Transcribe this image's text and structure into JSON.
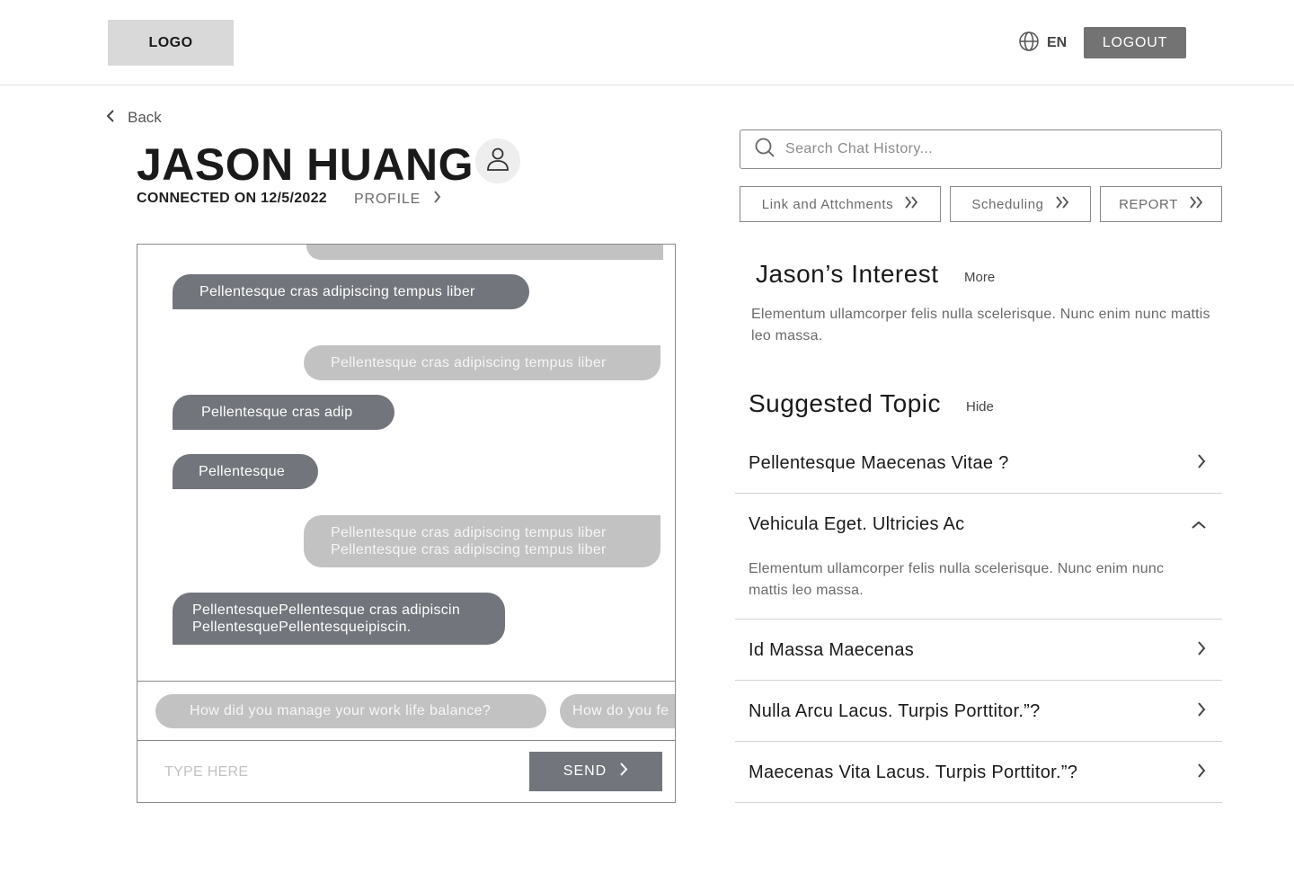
{
  "header": {
    "logo_text": "LOGO",
    "language": "EN",
    "logout_label": "LOGOUT"
  },
  "nav": {
    "back_label": "Back"
  },
  "contact": {
    "name": "JASON HUANG",
    "connected": "CONNECTED ON 12/5/2022",
    "profile_label": "PROFILE"
  },
  "chat": {
    "messages": [
      {
        "side": "in",
        "lines": [
          "Pellentesque cras adipiscing tempus liber"
        ]
      },
      {
        "side": "out",
        "lines": [
          "Pellentesque cras adipiscing tempus liber"
        ]
      },
      {
        "side": "in",
        "lines": [
          "Pellentesque cras adip"
        ]
      },
      {
        "side": "in",
        "lines": [
          "Pellentesque"
        ]
      },
      {
        "side": "out",
        "lines": [
          "Pellentesque cras adipiscing tempus liber",
          "Pellentesque cras adipiscing tempus liber"
        ]
      },
      {
        "side": "in",
        "lines": [
          "PellentesquePellentesque cras adipiscin",
          "PellentesquePellentesqueipiscin."
        ]
      }
    ],
    "suggestions": [
      "How did you manage your work life balance?",
      "How do you fe"
    ],
    "input_placeholder": "TYPE HERE",
    "send_label": "SEND"
  },
  "search": {
    "placeholder": "Search Chat History..."
  },
  "tabs": [
    {
      "label": "Link and Attchments"
    },
    {
      "label": "Scheduling"
    },
    {
      "label": "REPORT"
    }
  ],
  "interest": {
    "title": "Jason’s Interest",
    "more_label": "More",
    "text": "Elementum ullamcorper felis nulla scelerisque. Nunc enim nunc mattis leo massa."
  },
  "topics": {
    "title": "Suggested Topic",
    "hide_label": "Hide",
    "items": [
      {
        "label": "Pellentesque Maecenas Vitae ?",
        "expanded": false
      },
      {
        "label": "Vehicula Eget. Ultricies Ac",
        "expanded": true,
        "detail": "Elementum ullamcorper felis nulla scelerisque. Nunc enim nunc mattis leo massa."
      },
      {
        "label": "Id Massa Maecenas",
        "expanded": false
      },
      {
        "label": "Nulla Arcu Lacus. Turpis Porttitor.”?",
        "expanded": false
      },
      {
        "label": "Maecenas Vita Lacus. Turpis Porttitor.”?",
        "expanded": false
      }
    ]
  },
  "colors": {
    "incoming_bubble": "#72767c",
    "outgoing_bubble": "#c2c2c2",
    "logout_button": "#737373",
    "logo_box": "#d9d9d9"
  }
}
